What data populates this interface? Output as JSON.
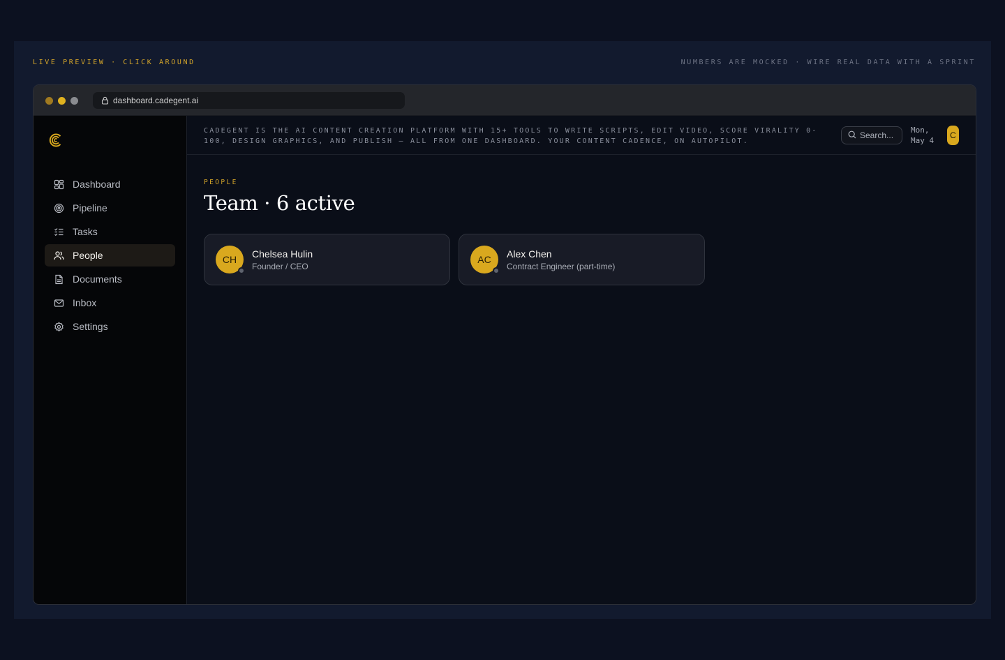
{
  "captions": {
    "left": "LIVE PREVIEW · CLICK AROUND",
    "right": "NUMBERS ARE MOCKED · WIRE REAL DATA WITH A SPRINT"
  },
  "browser": {
    "url": "dashboard.cadegent.ai"
  },
  "brand": {
    "accent": "#d9a81e",
    "logo_icon": "cadegent-c-logo"
  },
  "sidebar": {
    "items": [
      {
        "label": "Dashboard",
        "icon": "grid-icon",
        "active": false
      },
      {
        "label": "Pipeline",
        "icon": "target-icon",
        "active": false
      },
      {
        "label": "Tasks",
        "icon": "checklist-icon",
        "active": false
      },
      {
        "label": "People",
        "icon": "users-icon",
        "active": true
      },
      {
        "label": "Documents",
        "icon": "document-icon",
        "active": false
      },
      {
        "label": "Inbox",
        "icon": "mail-icon",
        "active": false
      },
      {
        "label": "Settings",
        "icon": "gear-icon",
        "active": false
      }
    ]
  },
  "topbar": {
    "tagline": "CADEGENT IS THE AI CONTENT CREATION PLATFORM WITH 15+ TOOLS TO WRITE SCRIPTS, EDIT VIDEO, SCORE VIRALITY 0-100, DESIGN GRAPHICS, AND PUBLISH — ALL FROM ONE DASHBOARD. YOUR CONTENT CADENCE, ON AUTOPILOT.",
    "search_placeholder": "Search...",
    "date": "Mon, May 4",
    "user_initial": "C"
  },
  "page": {
    "section": "PEOPLE",
    "title": "Team · 6 active"
  },
  "people": [
    {
      "initials": "CH",
      "name": "Chelsea Hulin",
      "role": "Founder / CEO"
    },
    {
      "initials": "AC",
      "name": "Alex Chen",
      "role": "Contract Engineer (part-time)"
    }
  ]
}
